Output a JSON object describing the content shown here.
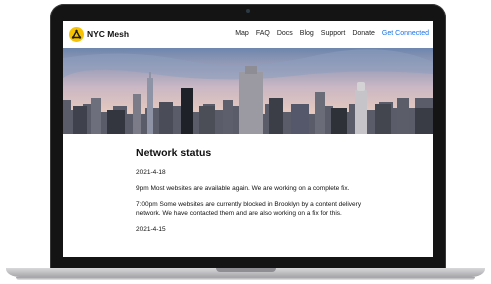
{
  "site": {
    "brand": "NYC Mesh",
    "nav": [
      {
        "label": "Map"
      },
      {
        "label": "FAQ"
      },
      {
        "label": "Docs"
      },
      {
        "label": "Blog"
      },
      {
        "label": "Support"
      },
      {
        "label": "Donate"
      },
      {
        "label": "Get Connected"
      }
    ],
    "accent_color": "#1a73e8",
    "logo_color": "#f7c300"
  },
  "page": {
    "title": "Network status",
    "entries": [
      "2021-4-18",
      "9pm Most websites are available again. We are working on a complete fix.",
      "7:00pm Some websites are currently blocked in Brooklyn by a content delivery network. We have contacted them and are also working on a fix for this.",
      "2021-4-15"
    ]
  },
  "icons": {
    "logo": "mesh-logo-icon",
    "camera": "camera-icon"
  }
}
